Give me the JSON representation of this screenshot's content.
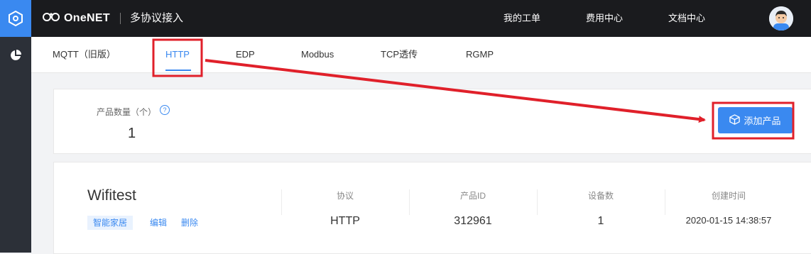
{
  "brand": {
    "name": "OneNET"
  },
  "header": {
    "title": "多协议接入",
    "links": [
      "我的工单",
      "费用中心",
      "文档中心"
    ]
  },
  "tabs": [
    "MQTT（旧版）",
    "HTTP",
    "EDP",
    "Modbus",
    "TCP透传",
    "RGMP"
  ],
  "active_tab": "HTTP",
  "summary": {
    "count_label": "产品数量（个）",
    "count_value": "1",
    "add_button": "添加产品"
  },
  "product": {
    "name": "Wifitest",
    "tag": "智能家居",
    "actions": [
      "编辑",
      "删除"
    ],
    "columns": [
      {
        "label": "协议",
        "value": "HTTP"
      },
      {
        "label": "产品ID",
        "value": "312961"
      },
      {
        "label": "设备数",
        "value": "1"
      },
      {
        "label": "创建时间",
        "value": "2020-01-15 14:38:57"
      }
    ]
  },
  "colors": {
    "accent": "#3a89f0",
    "annotation": "#e0202a",
    "topbar": "#1a1b1e",
    "rail": "#2c3038"
  },
  "icons": [
    "hexagon-logo-icon",
    "pie-chart-icon",
    "onenet-logo-icon",
    "help-icon",
    "box-icon",
    "user-avatar-icon"
  ]
}
